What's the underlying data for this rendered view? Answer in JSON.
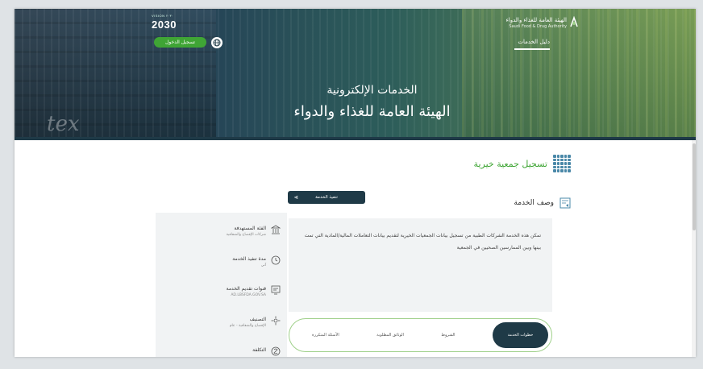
{
  "header": {
    "vision_logo": "2030",
    "vision_sub": "VISION ٢٠٣٠",
    "login_label": "تسجيل الدخول",
    "sfda_name_ar": "الهيئة العامة للغذاء والدواء",
    "sfda_name_en": "Saudi Food & Drug Authority",
    "nav_guide": "دليل الخدمات",
    "bg_mark": "tex"
  },
  "hero": {
    "line1": "الخدمات الإلكترونية",
    "line2": "الهيئة العامة للغذاء والدواء"
  },
  "service": {
    "title": "تسجيل جمعية خيرية",
    "description_heading": "وصف الخدمة",
    "execute_button": "تنفيذ الخدمة",
    "description": "تمكن هذه الخدمة الشركات الطبية من تسجيل بيانات الجمعيات الخيرية لتقديم بيانات التعاملات المالية/المادية التي تمت بينها وبين الممارسين الصحيين في الجمعية"
  },
  "info_panel": {
    "items": [
      {
        "label": "الفئة المستهدفة",
        "value": "شركات الإفصاح والشفافية",
        "icon": "building-icon"
      },
      {
        "label": "مدة تنفيذ الخدمة",
        "value": "آني",
        "icon": "clock-icon"
      },
      {
        "label": "قنوات تقديم الخدمة",
        "value": "AD.LBSFDA.GOV.SA",
        "icon": "channels-icon"
      },
      {
        "label": "التصنيف",
        "value": "الإفصاح والشفافية - عام",
        "icon": "category-icon"
      },
      {
        "label": "التكلفة",
        "value": "",
        "icon": "cost-icon"
      }
    ]
  },
  "tabs": [
    {
      "label": "خطوات الخدمة",
      "active": true
    },
    {
      "label": "الشروط",
      "active": false
    },
    {
      "label": "الوثائق المطلوبة",
      "active": false
    },
    {
      "label": "الأسئلة المتكررة",
      "active": false
    }
  ],
  "colors": {
    "primary_dark": "#1f3a47",
    "accent_green": "#3fa535",
    "panel_gray": "#f1f3f4"
  }
}
